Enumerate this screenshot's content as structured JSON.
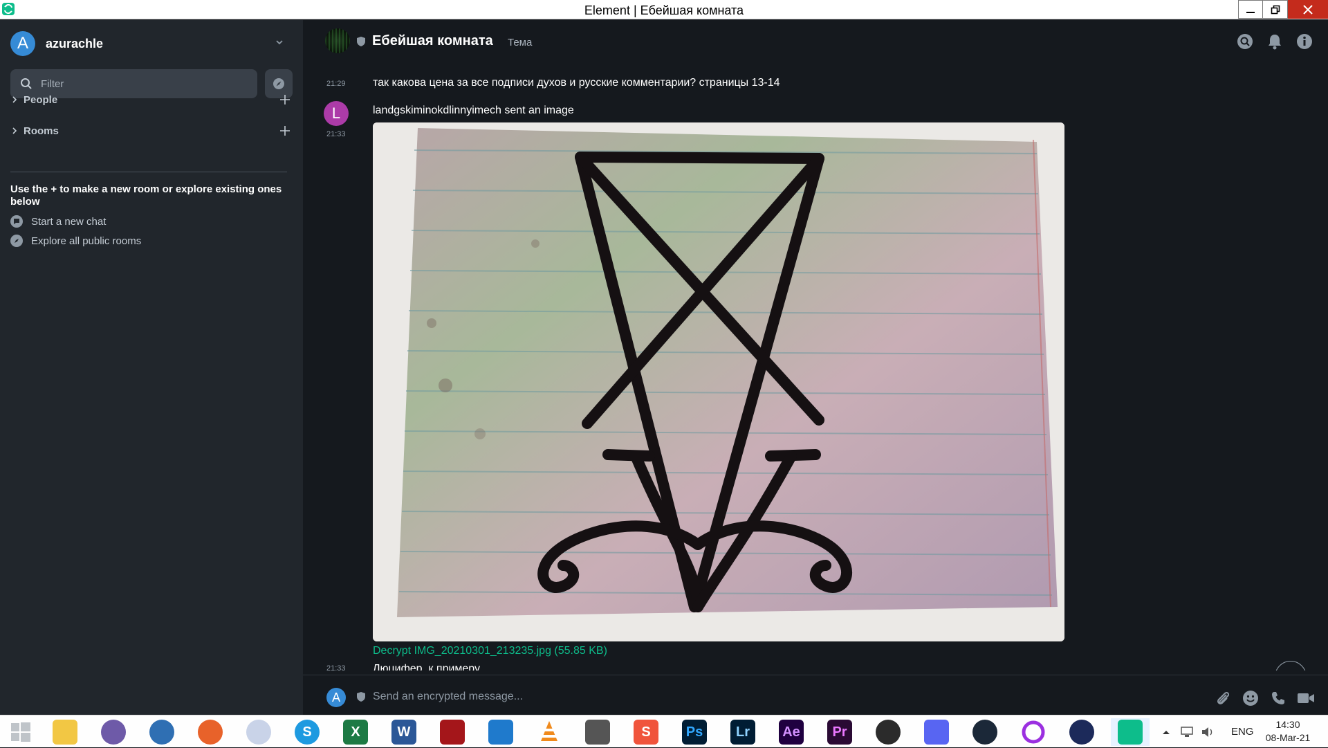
{
  "window": {
    "title": "Element | Ебейшая комната"
  },
  "sidebar": {
    "profile_initial": "A",
    "profile_name": "azurachle",
    "filter_placeholder": "Filter",
    "sections": [
      {
        "label": "People"
      },
      {
        "label": "Rooms"
      }
    ],
    "hint": "Use the + to make a new room or explore existing ones below",
    "links": [
      {
        "label": "Start a new chat",
        "icon": "chat-bubble-icon"
      },
      {
        "label": "Explore all public rooms",
        "icon": "compass-icon"
      }
    ]
  },
  "room": {
    "name": "Ебейшая комната",
    "topic": "Тема"
  },
  "timeline": {
    "messages": [
      {
        "time": "21:29",
        "text": "так какова цена за все подписи духов и русские комментарии? страницы 13-14"
      },
      {
        "time": "21:33",
        "sender_initial": "L",
        "text": "landgskiminokdlinnyimech sent an image"
      }
    ],
    "attachment": {
      "link_text": "Decrypt IMG_20210301_213235.jpg (55.85 KB)",
      "image_description_icon": "sigil-image"
    },
    "cut_message": {
      "time": "21:33",
      "text": "Люцифер, к примеру"
    }
  },
  "composer": {
    "avatar_initial": "A",
    "placeholder": "Send an encrypted message..."
  },
  "taskbar": {
    "apps": [
      {
        "name": "start-button",
        "label": ""
      },
      {
        "name": "file-explorer",
        "label": ""
      },
      {
        "name": "app-3",
        "label": ""
      },
      {
        "name": "app-4",
        "label": ""
      },
      {
        "name": "firefox",
        "label": ""
      },
      {
        "name": "app-6",
        "label": ""
      },
      {
        "name": "skype",
        "label": "S"
      },
      {
        "name": "excel",
        "label": "X"
      },
      {
        "name": "word",
        "label": "W"
      },
      {
        "name": "acrobat",
        "label": ""
      },
      {
        "name": "vscode",
        "label": ""
      },
      {
        "name": "vlc",
        "label": ""
      },
      {
        "name": "downloader",
        "label": ""
      },
      {
        "name": "app-s",
        "label": "S"
      },
      {
        "name": "photoshop",
        "label": "Ps"
      },
      {
        "name": "lightroom",
        "label": "Lr"
      },
      {
        "name": "after-effects",
        "label": "Ae"
      },
      {
        "name": "premiere",
        "label": "Pr"
      },
      {
        "name": "obs",
        "label": ""
      },
      {
        "name": "discord",
        "label": ""
      },
      {
        "name": "steam",
        "label": ""
      },
      {
        "name": "app-ring",
        "label": ""
      },
      {
        "name": "vpn-lock",
        "label": ""
      },
      {
        "name": "element",
        "label": ""
      }
    ],
    "tray": {
      "language": "ENG",
      "time": "14:30",
      "date": "08-Mar-21"
    }
  },
  "colors": {
    "accent": "#0dbd8b",
    "sidebar_bg": "#21262c",
    "main_bg": "#15191e",
    "profile_avatar": "#368bd6",
    "sender_avatar": "#ac3ba8"
  }
}
